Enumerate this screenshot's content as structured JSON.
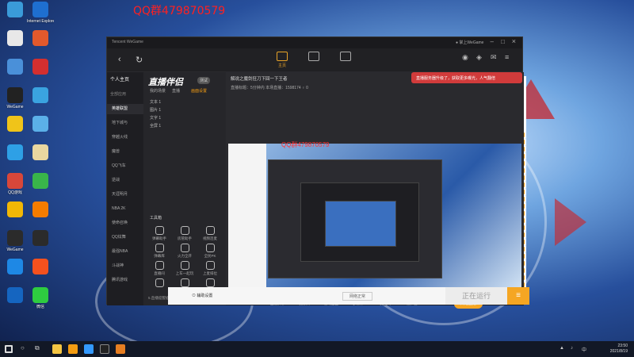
{
  "watermark": "QQ群479870579",
  "desktop_icons": [
    {
      "label": "",
      "color": "#3a9bd9"
    },
    {
      "label": "Internet Explorer",
      "color": "#1e6fd0"
    },
    {
      "label": "",
      "color": "#e8e8e8"
    },
    {
      "label": "",
      "color": "#e2592c"
    },
    {
      "label": "",
      "color": "#4a90d9"
    },
    {
      "label": "",
      "color": "#d32f2f"
    },
    {
      "label": "WeGame",
      "color": "#222"
    },
    {
      "label": "",
      "color": "#3aa3e0"
    },
    {
      "label": "",
      "color": "#f0c419"
    },
    {
      "label": "",
      "color": "#5bb0e8"
    },
    {
      "label": "",
      "color": "#2ea0e6"
    },
    {
      "label": "",
      "color": "#e9d7a0"
    },
    {
      "label": "QQ游戏",
      "color": "#d8473a"
    },
    {
      "label": "",
      "color": "#39b54a"
    },
    {
      "label": "",
      "color": "#f2b705"
    },
    {
      "label": "",
      "color": "#f57c00"
    },
    {
      "label": "WeGame",
      "color": "#2b2b2b"
    },
    {
      "label": "",
      "color": "#2b2b2b"
    },
    {
      "label": "",
      "color": "#1e88e5"
    },
    {
      "label": "",
      "color": "#f4511e"
    },
    {
      "label": "",
      "color": "#1565c0"
    },
    {
      "label": "微信",
      "color": "#2ecc40"
    }
  ],
  "window": {
    "title": "Tencent WeGame",
    "home_tab": "主页",
    "user_tag": "● 掌上WeGame"
  },
  "sidebar": {
    "header": "个人主页",
    "section": "全部应用",
    "items": [
      "英雄联盟",
      "地下城与",
      "穿越火线",
      "魔兽",
      "QQ飞车",
      "逆战",
      "天涯明月",
      "NBA 2K",
      "使命召唤",
      "QQ炫舞",
      "最强NBA",
      "斗战神",
      "腾讯游戏"
    ]
  },
  "panel": {
    "logo": "直播伴侣",
    "badge": "测试",
    "tabs": [
      "我的场景",
      "直播",
      "画面设置"
    ],
    "scenes": [
      "文本 1",
      "图片 1",
      "文字 1",
      "全屏 1"
    ],
    "tools_header": "工具箱",
    "tools": [
      "弹幕助手",
      "房管助手",
      "视频连麦",
      "弹幕库",
      "火力全开",
      "全民PK",
      "直播间",
      "上车一起玩",
      "上麦排位",
      "",
      "",
      ""
    ],
    "footer_note": "5.直播提醒插件已开启"
  },
  "main": {
    "title": "解说之魔剑狂刀下回一下王者",
    "subtitle": "直播标题：5分钟内   本场直播：1598174   ♀ 0",
    "banner": "直播服务器升级了，获取更多曝光，人气翻倍",
    "watermark": "QQ群479870579"
  },
  "bottom_tools": [
    "直播屏幕",
    "摄像头",
    "游戏画面",
    "多媒体",
    "麦克风",
    "扬声器"
  ],
  "go_live": "开始直播",
  "popup": {
    "label": "⊙ 辅助设置",
    "dropdown": "网络正常",
    "running": "正在运行",
    "menu_icon": "≡"
  },
  "taskbar": {
    "time": "23:50",
    "date": "2021/8/19",
    "input_method": "中",
    "tray_icons": [
      "network-icon",
      "volume-icon"
    ]
  }
}
